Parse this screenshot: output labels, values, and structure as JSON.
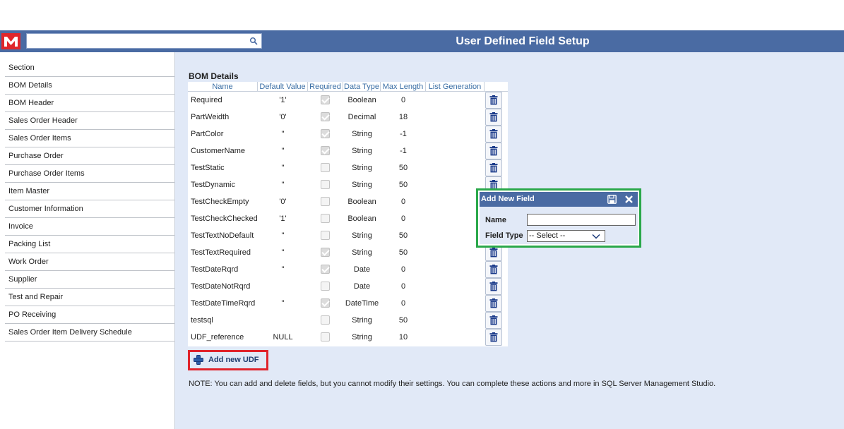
{
  "header": {
    "title": "User Defined Field Setup",
    "logo_letter": "M",
    "search_placeholder": ""
  },
  "sidebar": {
    "items": [
      {
        "label": "Section"
      },
      {
        "label": "BOM Details"
      },
      {
        "label": "BOM Header"
      },
      {
        "label": "Sales Order Header"
      },
      {
        "label": "Sales Order Items"
      },
      {
        "label": "Purchase Order"
      },
      {
        "label": "Purchase Order Items"
      },
      {
        "label": "Item Master"
      },
      {
        "label": "Customer Information"
      },
      {
        "label": "Invoice"
      },
      {
        "label": "Packing List"
      },
      {
        "label": "Work Order"
      },
      {
        "label": "Supplier"
      },
      {
        "label": "Test and Repair"
      },
      {
        "label": "PO Receiving"
      },
      {
        "label": "Sales Order Item Delivery Schedule"
      }
    ]
  },
  "main": {
    "section_title": "BOM Details",
    "columns": [
      "Name",
      "Default Value",
      "Required",
      "Data Type",
      "Max Length",
      "List Generation"
    ],
    "rows": [
      {
        "name": "Required",
        "default": "'1'",
        "required": true,
        "type": "Boolean",
        "max": "0"
      },
      {
        "name": "PartWeidth",
        "default": "'0'",
        "required": true,
        "type": "Decimal",
        "max": "18"
      },
      {
        "name": "PartColor",
        "default": "''",
        "required": true,
        "type": "String",
        "max": "-1"
      },
      {
        "name": "CustomerName",
        "default": "''",
        "required": true,
        "type": "String",
        "max": "-1"
      },
      {
        "name": "TestStatic",
        "default": "''",
        "required": false,
        "type": "String",
        "max": "50"
      },
      {
        "name": "TestDynamic",
        "default": "''",
        "required": false,
        "type": "String",
        "max": "50"
      },
      {
        "name": "TestCheckEmpty",
        "default": "'0'",
        "required": false,
        "type": "Boolean",
        "max": "0"
      },
      {
        "name": "TestCheckChecked",
        "default": "'1'",
        "required": false,
        "type": "Boolean",
        "max": "0"
      },
      {
        "name": "TestTextNoDefault",
        "default": "''",
        "required": false,
        "type": "String",
        "max": "50"
      },
      {
        "name": "TestTextRequired",
        "default": "''",
        "required": true,
        "type": "String",
        "max": "50"
      },
      {
        "name": "TestDateRqrd",
        "default": "''",
        "required": true,
        "type": "Date",
        "max": "0"
      },
      {
        "name": "TestDateNotRqrd",
        "default": "",
        "required": false,
        "type": "Date",
        "max": "0"
      },
      {
        "name": "TestDateTimeRqrd",
        "default": "''",
        "required": true,
        "type": "DateTime",
        "max": "0"
      },
      {
        "name": "testsql",
        "default": "",
        "required": false,
        "type": "String",
        "max": "50"
      },
      {
        "name": "UDF_reference",
        "default": "NULL",
        "required": false,
        "type": "String",
        "max": "10"
      }
    ],
    "add_button_label": "Add new UDF",
    "note": "NOTE: You can add and delete fields, but you cannot modify their settings. You can complete these actions and more in SQL Server Management Studio."
  },
  "popup": {
    "title": "Add New Field",
    "name_label": "Name",
    "name_value": "",
    "type_label": "Field Type",
    "type_selected": "-- Select --"
  },
  "colors": {
    "header_bg": "#4a6ba3",
    "content_bg": "#e1e9f7",
    "logo_red": "#e0262b",
    "highlight_red": "#e0232b",
    "highlight_green": "#2aa84a",
    "trash_blue": "#1a3a8a"
  }
}
